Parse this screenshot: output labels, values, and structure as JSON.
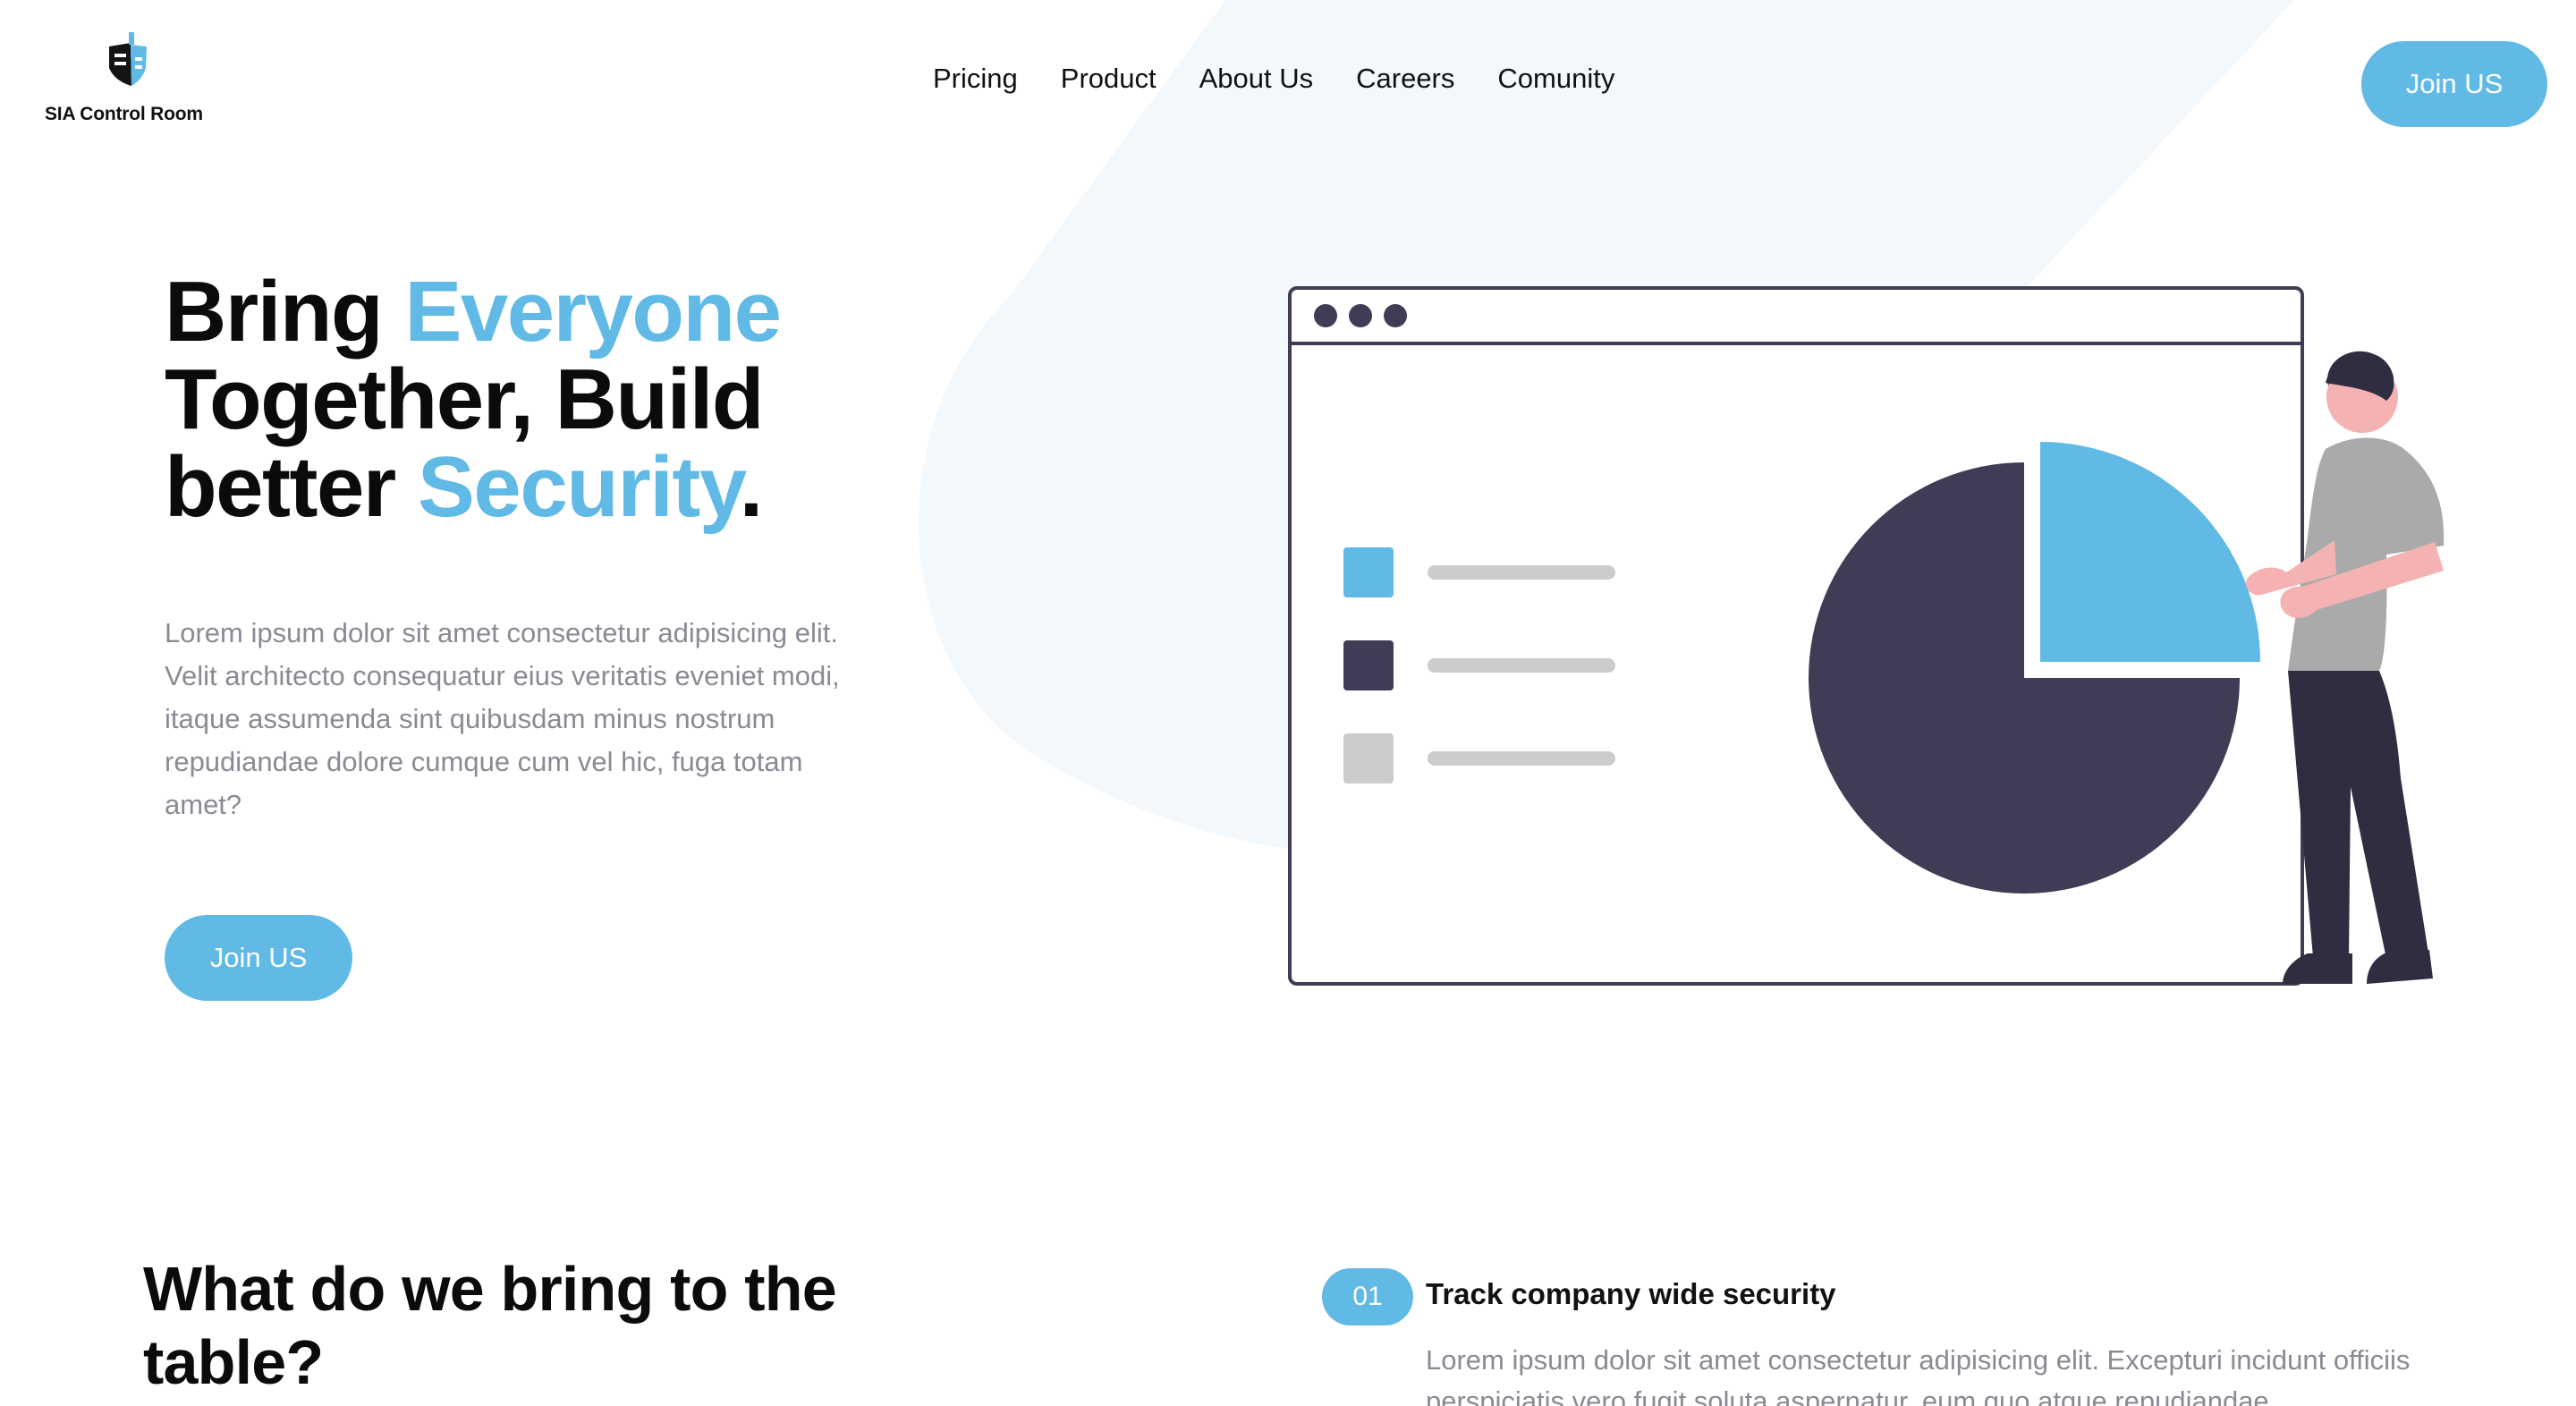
{
  "brand": {
    "name": "SIA Control Room",
    "accent": "#61b9e5",
    "dark": "#3f3d56"
  },
  "nav": {
    "items": [
      "Pricing",
      "Product",
      "About Us",
      "Careers",
      "Comunity"
    ]
  },
  "header": {
    "cta_label": "Join US"
  },
  "hero": {
    "title_1": "Bring ",
    "title_hl_1": "Everyone",
    "title_2": "Together, Build",
    "title_3": "better ",
    "title_hl_2": "Security",
    "title_end": ".",
    "description": "Lorem ipsum dolor sit amet consectetur adipisicing elit. Velit architecto consequatur eius veritatis eveniet modi, itaque assumenda sint quibusdam minus nostrum repudiandae dolore cumque cum vel hic, fuga totam amet?",
    "cta_label": "Join US"
  },
  "section": {
    "title": "What do we bring to the table?",
    "feature": {
      "number": "01",
      "title": "Track company wide security",
      "description": "Lorem ipsum dolor sit amet consectetur adipisicing elit. Excepturi incidunt officiis perspiciatis vero fugit soluta aspernatur, eum quo atque repudiandae"
    }
  },
  "icons": {
    "logo": "shield-logo-icon",
    "illustration": "presentation-pie-chart-illustration"
  }
}
